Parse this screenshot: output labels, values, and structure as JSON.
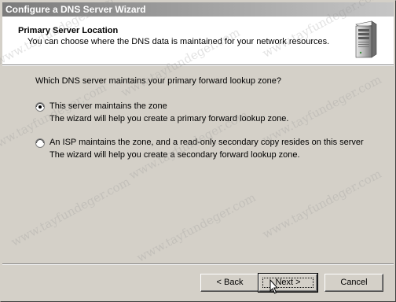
{
  "window": {
    "title": "Configure a DNS Server Wizard"
  },
  "header": {
    "title": "Primary Server Location",
    "subtitle": "You can choose where the DNS data is maintained for your network resources."
  },
  "question": "Which DNS server maintains your primary forward lookup zone?",
  "options": [
    {
      "label": "This server maintains the zone",
      "description": "The wizard will help you create a primary forward lookup zone.",
      "selected": true
    },
    {
      "label": "An ISP maintains the zone, and a read-only secondary copy resides on this server",
      "description": "The wizard will help you create a secondary forward lookup zone.",
      "selected": false
    }
  ],
  "buttons": {
    "back": "< Back",
    "next": "Next >",
    "cancel": "Cancel"
  },
  "watermark": "www.tayfundeger.com"
}
